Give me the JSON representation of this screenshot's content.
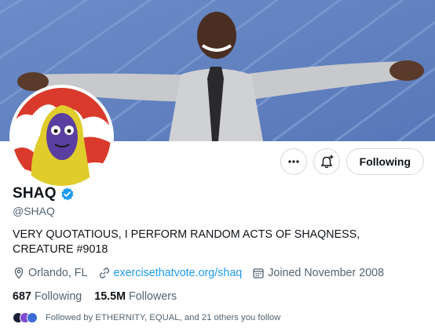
{
  "profile": {
    "name": "SHAQ",
    "handle": "@SHAQ",
    "verified": true,
    "bio": "VERY QUOTATIOUS, I PERFORM RANDOM ACTS OF SHAQNESS, CREATURE #9018",
    "location": "Orlando, FL",
    "website": "exercisethatvote.org/shaq",
    "joined": "Joined November 2008"
  },
  "actions": {
    "more_icon": "more-horizontal-icon",
    "notify_icon": "bell-plus-icon",
    "follow_label": "Following"
  },
  "stats": {
    "following_count": "687",
    "following_label": "Following",
    "followers_count": "15.5M",
    "followers_label": "Followers"
  },
  "followed_by": "Followed by ETHERNITY, EQUAL, and 21 others you follow",
  "colors": {
    "accent": "#1d9bf0",
    "text": "#0f1419",
    "secondary": "#536471",
    "border": "#cfd9de",
    "banner_sky": "#6f8fc6"
  }
}
